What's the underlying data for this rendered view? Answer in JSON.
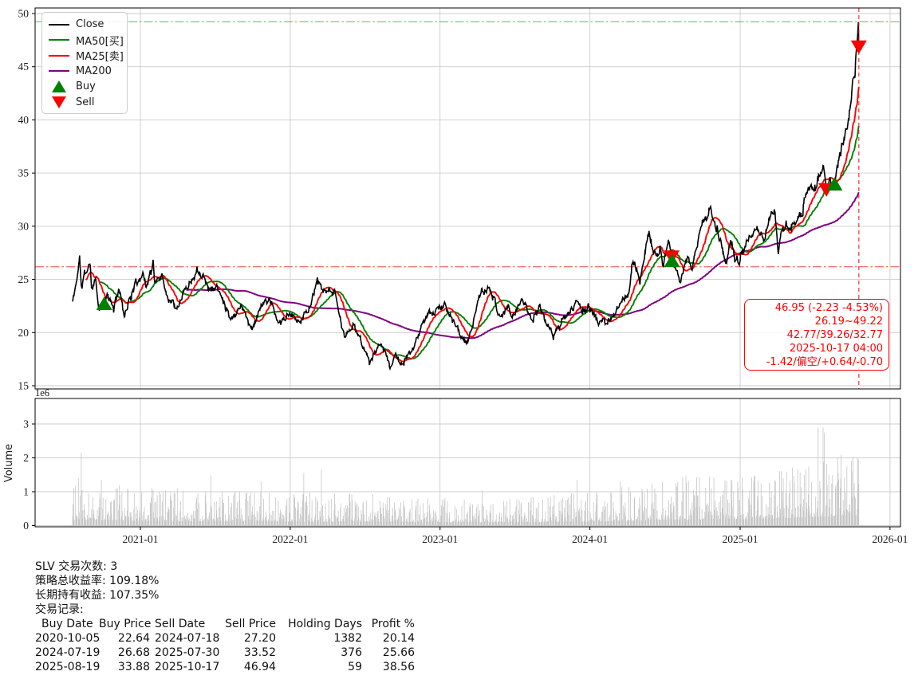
{
  "chart_data": {
    "type": "line",
    "symbol": "SLV",
    "x_axis": {
      "ticks": [
        {
          "label": "2021-01",
          "date": "2021-01-01"
        },
        {
          "label": "2022-01",
          "date": "2022-01-01"
        },
        {
          "label": "2023-01",
          "date": "2023-01-01"
        },
        {
          "label": "2024-01",
          "date": "2024-01-01"
        },
        {
          "label": "2025-01",
          "date": "2025-01-01"
        },
        {
          "label": "2026-01",
          "date": "2026-01-01"
        }
      ],
      "range": [
        "2020-04-18",
        "2026-01-26"
      ]
    },
    "price_panel": {
      "ylim": [
        14.7,
        50.52
      ],
      "yticks": [
        15,
        20,
        25,
        30,
        35,
        40,
        45,
        50
      ],
      "grid": true,
      "start": "2020-07-20",
      "end": "2025-10-17",
      "close_color": "#000000",
      "ma25_color": "#ff0000",
      "ma50_color": "#008000",
      "ma200_color": "#800080",
      "high_line": 49.22,
      "low_line": 26.19,
      "crosshair_date": "2025-10-17",
      "last_close": 46.95,
      "close_anchors": [
        [
          "2020-07-20",
          22.9
        ],
        [
          "2020-07-28",
          24.5
        ],
        [
          "2020-08-06",
          27.0
        ],
        [
          "2020-08-11",
          24.1
        ],
        [
          "2020-08-17",
          25.4
        ],
        [
          "2020-09-01",
          26.4
        ],
        [
          "2020-09-04",
          24.3
        ],
        [
          "2020-09-14",
          25.0
        ],
        [
          "2020-09-23",
          22.2
        ],
        [
          "2020-10-05",
          22.64
        ],
        [
          "2020-10-12",
          23.6
        ],
        [
          "2020-10-29",
          22.2
        ],
        [
          "2020-11-09",
          24.3
        ],
        [
          "2020-11-23",
          21.7
        ],
        [
          "2020-12-01",
          22.6
        ],
        [
          "2020-12-17",
          24.2
        ],
        [
          "2021-01-06",
          25.7
        ],
        [
          "2021-01-15",
          24.4
        ],
        [
          "2021-01-29",
          26.0
        ],
        [
          "2021-02-01",
          26.9
        ],
        [
          "2021-02-04",
          24.6
        ],
        [
          "2021-02-22",
          25.5
        ],
        [
          "2021-03-08",
          23.3
        ],
        [
          "2021-03-31",
          22.5
        ],
        [
          "2021-04-20",
          24.1
        ],
        [
          "2021-05-07",
          25.0
        ],
        [
          "2021-05-18",
          26.0
        ],
        [
          "2021-06-02",
          25.6
        ],
        [
          "2021-06-18",
          24.0
        ],
        [
          "2021-07-06",
          24.3
        ],
        [
          "2021-07-19",
          23.3
        ],
        [
          "2021-08-09",
          21.4
        ],
        [
          "2021-08-20",
          21.7
        ],
        [
          "2021-09-03",
          22.7
        ],
        [
          "2021-09-17",
          21.4
        ],
        [
          "2021-09-29",
          20.3
        ],
        [
          "2021-10-21",
          22.5
        ],
        [
          "2021-11-12",
          23.2
        ],
        [
          "2021-12-02",
          20.9
        ],
        [
          "2021-12-15",
          21.2
        ],
        [
          "2021-12-31",
          21.6
        ],
        [
          "2022-01-25",
          21.1
        ],
        [
          "2022-02-15",
          22.2
        ],
        [
          "2022-03-08",
          24.7
        ],
        [
          "2022-03-29",
          23.6
        ],
        [
          "2022-04-18",
          24.0
        ],
        [
          "2022-05-02",
          21.4
        ],
        [
          "2022-05-13",
          19.6
        ],
        [
          "2022-06-03",
          20.6
        ],
        [
          "2022-06-17",
          19.8
        ],
        [
          "2022-07-14",
          17.2
        ],
        [
          "2022-08-12",
          19.2
        ],
        [
          "2022-09-01",
          16.7
        ],
        [
          "2022-09-15",
          17.9
        ],
        [
          "2022-09-28",
          16.9
        ],
        [
          "2022-10-21",
          18.0
        ],
        [
          "2022-11-15",
          20.3
        ],
        [
          "2022-12-05",
          21.9
        ],
        [
          "2022-12-20",
          22.0
        ],
        [
          "2023-01-13",
          22.6
        ],
        [
          "2023-02-03",
          20.9
        ],
        [
          "2023-03-08",
          18.8
        ],
        [
          "2023-03-31",
          22.4
        ],
        [
          "2023-04-14",
          24.0
        ],
        [
          "2023-05-05",
          23.9
        ],
        [
          "2023-05-25",
          21.6
        ],
        [
          "2023-06-16",
          22.4
        ],
        [
          "2023-06-26",
          21.3
        ],
        [
          "2023-07-20",
          23.3
        ],
        [
          "2023-08-15",
          21.1
        ],
        [
          "2023-09-01",
          22.4
        ],
        [
          "2023-10-04",
          19.6
        ],
        [
          "2023-10-27",
          21.3
        ],
        [
          "2023-11-21",
          22.1
        ],
        [
          "2023-12-01",
          23.3
        ],
        [
          "2023-12-13",
          22.0
        ],
        [
          "2023-12-29",
          22.4
        ],
        [
          "2024-01-22",
          21.0
        ],
        [
          "2024-02-09",
          20.9
        ],
        [
          "2024-03-01",
          21.6
        ],
        [
          "2024-03-20",
          23.1
        ],
        [
          "2024-04-01",
          23.2
        ],
        [
          "2024-04-12",
          26.1
        ],
        [
          "2024-04-19",
          26.6
        ],
        [
          "2024-05-02",
          24.9
        ],
        [
          "2024-05-23",
          29.4
        ],
        [
          "2024-06-07",
          27.2
        ],
        [
          "2024-06-21",
          28.0
        ],
        [
          "2024-06-26",
          26.2
        ],
        [
          "2024-07-11",
          28.5
        ],
        [
          "2024-07-18",
          27.2
        ],
        [
          "2024-07-19",
          26.68
        ],
        [
          "2024-08-07",
          24.7
        ],
        [
          "2024-08-27",
          27.4
        ],
        [
          "2024-09-06",
          26.0
        ],
        [
          "2024-09-26",
          29.7
        ],
        [
          "2024-10-22",
          31.8
        ],
        [
          "2024-11-01",
          30.3
        ],
        [
          "2024-11-15",
          28.4
        ],
        [
          "2024-11-29",
          26.5
        ],
        [
          "2024-12-09",
          28.9
        ],
        [
          "2024-12-19",
          27.0
        ],
        [
          "2024-12-30",
          26.6
        ],
        [
          "2025-01-16",
          28.3
        ],
        [
          "2025-01-31",
          28.9
        ],
        [
          "2025-02-14",
          30.0
        ],
        [
          "2025-02-28",
          28.8
        ],
        [
          "2025-03-18",
          31.2
        ],
        [
          "2025-03-27",
          31.4
        ],
        [
          "2025-04-04",
          27.6
        ],
        [
          "2025-04-11",
          29.4
        ],
        [
          "2025-04-23",
          30.1
        ],
        [
          "2025-05-06",
          29.8
        ],
        [
          "2025-05-23",
          30.7
        ],
        [
          "2025-06-02",
          31.0
        ],
        [
          "2025-06-06",
          32.7
        ],
        [
          "2025-06-18",
          33.4
        ],
        [
          "2025-07-03",
          33.8
        ],
        [
          "2025-07-14",
          34.7
        ],
        [
          "2025-07-23",
          35.6
        ],
        [
          "2025-07-30",
          33.52
        ],
        [
          "2025-08-08",
          34.6
        ],
        [
          "2025-08-15",
          33.4
        ],
        [
          "2025-08-19",
          33.88
        ],
        [
          "2025-08-29",
          36.2
        ],
        [
          "2025-09-12",
          38.1
        ],
        [
          "2025-09-23",
          40.6
        ],
        [
          "2025-09-30",
          42.6
        ],
        [
          "2025-10-03",
          43.8
        ],
        [
          "2025-10-08",
          44.6
        ],
        [
          "2025-10-10",
          46.3
        ],
        [
          "2025-10-14",
          47.8
        ],
        [
          "2025-10-16",
          49.2
        ],
        [
          "2025-10-17",
          46.95
        ]
      ],
      "pinned_dates": [
        "2020-10-05",
        "2024-07-18",
        "2024-07-19",
        "2025-07-30",
        "2025-08-19",
        "2025-10-14",
        "2025-10-16",
        "2025-10-17"
      ]
    },
    "trades": {
      "buys": [
        [
          "2020-10-05",
          22.64
        ],
        [
          "2024-07-19",
          26.68
        ],
        [
          "2025-08-19",
          33.88
        ]
      ],
      "sells": [
        [
          "2024-07-18",
          27.2
        ],
        [
          "2025-07-30",
          33.52
        ],
        [
          "2025-10-17",
          46.95
        ]
      ],
      "buy_color": "#008000",
      "sell_color": "#ff0000"
    },
    "volume_panel": {
      "ylim": [
        0,
        3.75
      ],
      "yticks": [
        0,
        1,
        2,
        3
      ],
      "offset_label": "1e6",
      "ylabel": "Volume",
      "bar_color": "#c6c6c6",
      "base_profile": [
        [
          "2020-07-20",
          0.32
        ],
        [
          "2021-01-01",
          0.25
        ],
        [
          "2021-07-01",
          0.22
        ],
        [
          "2022-06-01",
          0.2
        ],
        [
          "2023-06-01",
          0.17
        ],
        [
          "2024-01-01",
          0.21
        ],
        [
          "2024-07-01",
          0.3
        ],
        [
          "2025-01-01",
          0.33
        ],
        [
          "2025-05-01",
          0.4
        ],
        [
          "2025-10-17",
          0.55
        ]
      ],
      "spikes": [
        [
          "2020-08-10",
          2.15
        ],
        [
          "2020-08-12",
          1.05
        ],
        [
          "2020-09-24",
          0.95
        ],
        [
          "2021-02-01",
          1.05
        ],
        [
          "2021-07-19",
          1.0
        ],
        [
          "2021-10-22",
          1.3
        ],
        [
          "2022-02-03",
          1.55
        ],
        [
          "2022-03-18",
          1.65
        ],
        [
          "2023-04-14",
          1.05
        ],
        [
          "2023-10-06",
          0.9
        ],
        [
          "2023-12-01",
          1.35
        ],
        [
          "2024-03-15",
          1.3
        ],
        [
          "2024-07-31",
          1.15
        ],
        [
          "2024-10-23",
          1.1
        ],
        [
          "2024-12-10",
          1.35
        ],
        [
          "2025-04-07",
          1.6
        ],
        [
          "2025-06-06",
          1.5
        ],
        [
          "2025-07-25",
          2.75
        ],
        [
          "2025-09-30",
          1.6
        ],
        [
          "2025-10-14",
          2.0
        ],
        [
          "2025-10-16",
          1.95
        ]
      ]
    }
  },
  "legend": {
    "items": [
      {
        "label": "Close",
        "color": "#000000",
        "type": "line"
      },
      {
        "label": "MA50[买]",
        "color": "#008000",
        "type": "line"
      },
      {
        "label": "MA25[卖]",
        "color": "#ff0000",
        "type": "line"
      },
      {
        "label": "MA200",
        "color": "#800080",
        "type": "line"
      },
      {
        "label": "Buy",
        "color": "#008000",
        "type": "triangle-up"
      },
      {
        "label": "Sell",
        "color": "#ff0000",
        "type": "triangle-down"
      }
    ]
  },
  "annotation": {
    "color": "#ff0000",
    "lines": [
      "46.95 (-2.23 -4.53%)",
      "26.19~49.22",
      "42.77/39.26/32.77",
      "2025-10-17 04:00",
      "-1.42/偏空/+0.64/-0.70"
    ]
  },
  "summary": {
    "trade_count_line": "SLV 交易次数: 3",
    "strategy_return_line": "策略总收益率: 109.18%",
    "hold_return_line": "长期持有收益: 107.35%",
    "records_label": "交易记录:",
    "table": {
      "headers": [
        "Buy Date",
        "Buy Price",
        "Sell Date",
        "Sell Price",
        "Holding Days",
        "Profit %"
      ],
      "rows": [
        {
          "buy_date": "2020-10-05",
          "buy_price": "22.64",
          "sell_date": "2024-07-18",
          "sell_price": "27.20",
          "holding_days": "1382",
          "profit_pct": "20.14"
        },
        {
          "buy_date": "2024-07-19",
          "buy_price": "26.68",
          "sell_date": "2025-07-30",
          "sell_price": "33.52",
          "holding_days": "376",
          "profit_pct": "25.66"
        },
        {
          "buy_date": "2025-08-19",
          "buy_price": "33.88",
          "sell_date": "2025-10-17",
          "sell_price": "46.94",
          "holding_days": "59",
          "profit_pct": "38.56"
        }
      ]
    }
  }
}
